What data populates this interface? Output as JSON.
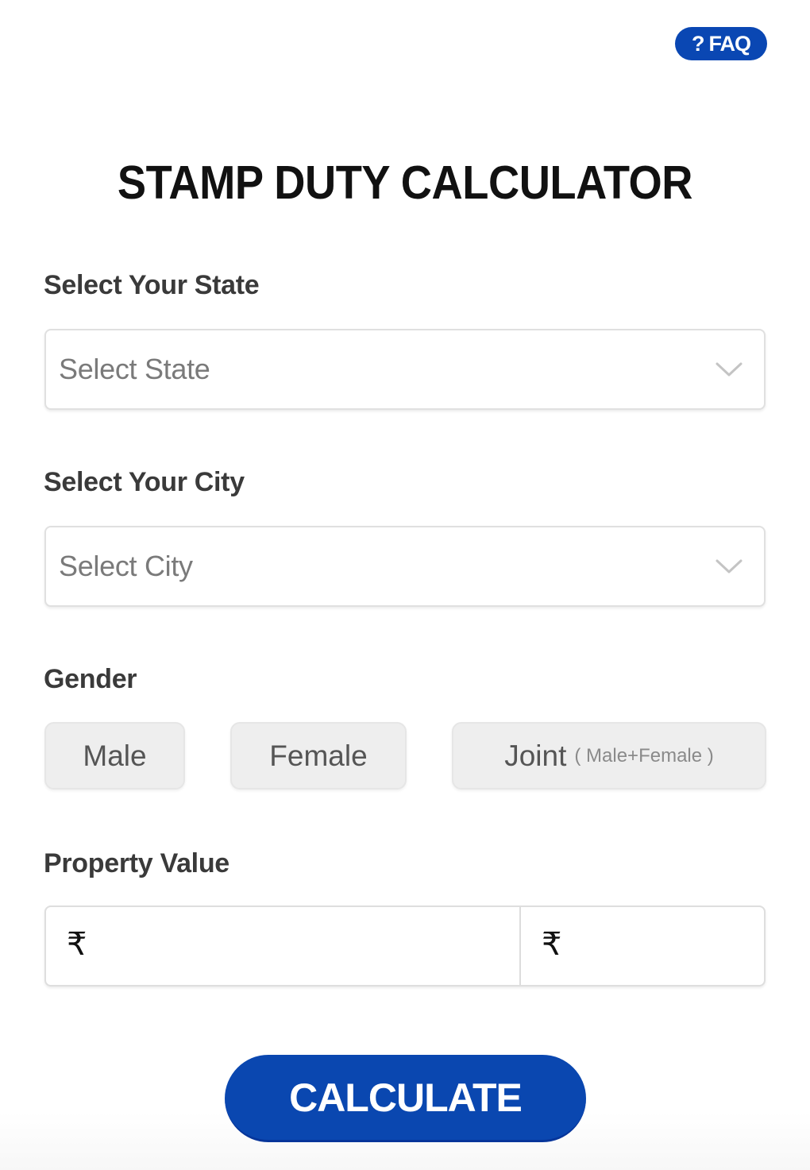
{
  "header": {
    "faq_icon": "question-mark-icon",
    "faq_icon_glyph": "?",
    "faq_label": "FAQ"
  },
  "title": "STAMP DUTY CALCULATOR",
  "state": {
    "label": "Select Your State",
    "placeholder": "Select State",
    "icon": "chevron-down-icon"
  },
  "city": {
    "label": "Select Your City",
    "placeholder": "Select City",
    "icon": "chevron-down-icon"
  },
  "gender": {
    "label": "Gender",
    "options": [
      {
        "label": "Male",
        "sub": ""
      },
      {
        "label": "Female",
        "sub": ""
      },
      {
        "label": "Joint",
        "sub": "( Male+Female )"
      }
    ]
  },
  "property_value": {
    "label": "Property Value",
    "currency_symbol": "₹",
    "fields": [
      {
        "value": "",
        "currency_symbol": "₹"
      },
      {
        "value": "",
        "currency_symbol": "₹"
      }
    ]
  },
  "actions": {
    "calculate_label": "CALCULATE"
  },
  "colors": {
    "accent": "#0a47b0",
    "button_gray": "#eeeeee",
    "title_text": "#111111",
    "label_text": "#3a3a3a",
    "placeholder_text": "#7a7a7a"
  }
}
